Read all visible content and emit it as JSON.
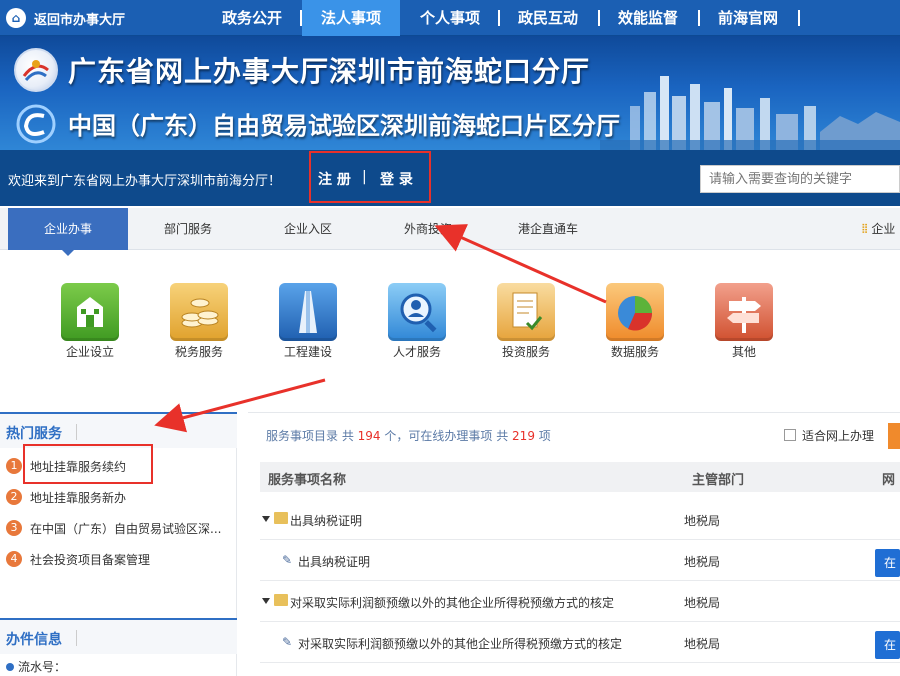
{
  "topnav": {
    "back_label": "返回市办事大厅",
    "items": [
      "政务公开",
      "法人事项",
      "个人事项",
      "政民互动",
      "效能监督",
      "前海官网"
    ],
    "active_index": 1
  },
  "banner": {
    "title_line1": "广东省网上办事大厅深圳市前海蛇口分厅",
    "title_line2": "中国（广东）自由贸易试验区深圳前海蛇口片区分厅"
  },
  "welcome": {
    "message": "欢迎来到广东省网上办事大厅深圳市前海分厅！",
    "register": "注 册",
    "separator": "|",
    "login": "登 录",
    "search_placeholder": "请输入需要查询的关键字"
  },
  "tabs": {
    "items": [
      "企业办事",
      "部门服务",
      "企业入区",
      "外商投资",
      "港企直通车"
    ],
    "active_index": 0,
    "right_link": "企业"
  },
  "service_icons": [
    {
      "label": "企业设立",
      "icon": "building-icon",
      "color": "#58b233"
    },
    {
      "label": "税务服务",
      "icon": "coins-icon",
      "color": "#e3a83a"
    },
    {
      "label": "工程建设",
      "icon": "tower-icon",
      "color": "#2f6fc4"
    },
    {
      "label": "人才服务",
      "icon": "person-search-icon",
      "color": "#2f86d6"
    },
    {
      "label": "投资服务",
      "icon": "document-check-icon",
      "color": "#e9a52f"
    },
    {
      "label": "数据服务",
      "icon": "pie-chart-icon",
      "color": "#f08a2c"
    },
    {
      "label": "其他",
      "icon": "signpost-icon",
      "color": "#d9553a"
    }
  ],
  "hot_services": {
    "title": "热门服务",
    "items": [
      {
        "num": "1",
        "label": "地址挂靠服务续约"
      },
      {
        "num": "2",
        "label": "地址挂靠服务新办"
      },
      {
        "num": "3",
        "label": "在中国（广东）自由贸易试验区深..."
      },
      {
        "num": "4",
        "label": "社会投资项目备案管理"
      }
    ]
  },
  "case_info": {
    "title": "办件信息",
    "serial_label": "流水号："
  },
  "service_list": {
    "summary_prefix": "服务事项目录 共",
    "total": "194",
    "summary_mid": "个，可在线办理事项 共",
    "online_total": "219",
    "summary_suffix": "项",
    "online_filter": "适合网上办理",
    "columns": [
      "服务事项名称",
      "主管部门",
      "网"
    ],
    "rows": [
      {
        "type": "group",
        "name": "出具纳税证明",
        "dept": "地税局"
      },
      {
        "type": "item",
        "name": "出具纳税证明",
        "dept": "地税局",
        "action": "在"
      },
      {
        "type": "group",
        "name": "对采取实际利润额预缴以外的其他企业所得税预缴方式的核定",
        "dept": "地税局"
      },
      {
        "type": "item",
        "name": "对采取实际利润额预缴以外的其他企业所得税预缴方式的核定",
        "dept": "地税局",
        "action": "在"
      }
    ]
  },
  "colors": {
    "nav_blue": "#1b5fb3",
    "nav_active": "#3a93e8",
    "welcome_bar": "#0e4a8c",
    "highlight_red": "#e8312a",
    "tab_active": "#3a6ebf",
    "count_red": "#e8312a"
  }
}
